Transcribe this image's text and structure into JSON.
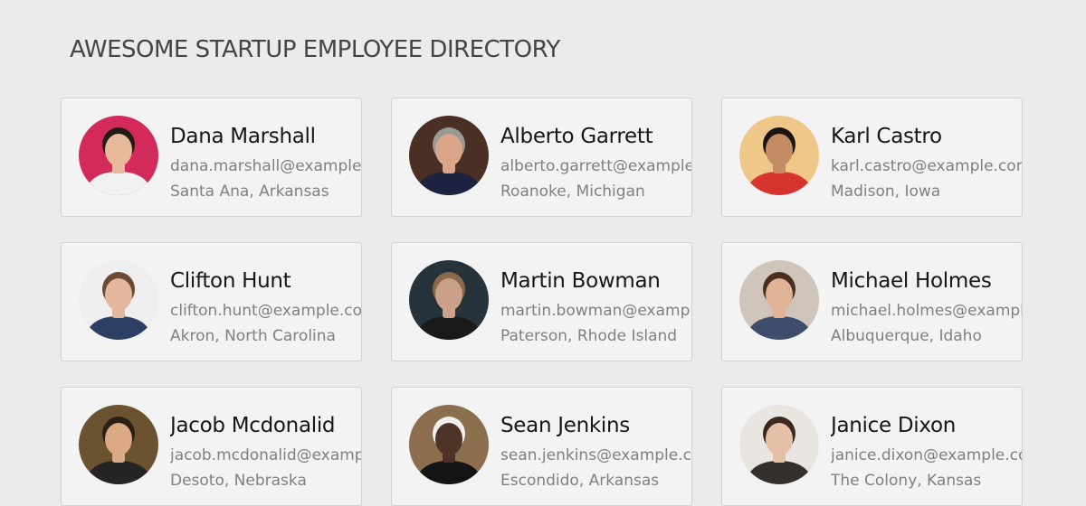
{
  "header": {
    "title": "AWESOME STARTUP EMPLOYEE DIRECTORY"
  },
  "employees": [
    {
      "name": "Dana Marshall",
      "email": "dana.marshall@example.com",
      "location": "Santa Ana, Arkansas",
      "avatar": {
        "bg": "#d22a5a",
        "skin": "#e8b89a",
        "hair": "#221a17",
        "shirt": "#f1f1f1"
      }
    },
    {
      "name": "Alberto Garrett",
      "email": "alberto.garrett@example.com",
      "location": "Roanoke, Michigan",
      "avatar": {
        "bg": "#4a2f24",
        "skin": "#dba58a",
        "hair": "#9a9a95",
        "shirt": "#1c2240"
      }
    },
    {
      "name": "Karl Castro",
      "email": "karl.castro@example.com",
      "location": "Madison, Iowa",
      "avatar": {
        "bg": "#efc789",
        "skin": "#c38c64",
        "hair": "#1a1411",
        "shirt": "#d6352f"
      }
    },
    {
      "name": "Clifton Hunt",
      "email": "clifton.hunt@example.com",
      "location": "Akron, North Carolina",
      "avatar": {
        "bg": "#eeeeee",
        "skin": "#e3b79d",
        "hair": "#6b4a34",
        "shirt": "#2e3f66"
      }
    },
    {
      "name": "Martin Bowman",
      "email": "martin.bowman@example.com",
      "location": "Paterson, Rhode Island",
      "avatar": {
        "bg": "#26333a",
        "skin": "#caa088",
        "hair": "#8a6a48",
        "shirt": "#1a1a1a"
      }
    },
    {
      "name": "Michael Holmes",
      "email": "michael.holmes@example.com",
      "location": "Albuquerque, Idaho",
      "avatar": {
        "bg": "#cfc5bb",
        "skin": "#e0b296",
        "hair": "#4a2e20",
        "shirt": "#3f4d6c"
      }
    },
    {
      "name": "Jacob Mcdonalid",
      "email": "jacob.mcdonalid@example.com",
      "location": "Desoto, Nebraska",
      "avatar": {
        "bg": "#6b5230",
        "skin": "#dba985",
        "hair": "#2a2018",
        "shirt": "#242424"
      }
    },
    {
      "name": "Sean Jenkins",
      "email": "sean.jenkins@example.com",
      "location": "Escondido, Arkansas",
      "avatar": {
        "bg": "#8a6e4e",
        "skin": "#4e3426",
        "hair": "#f0f0f0",
        "shirt": "#141414"
      }
    },
    {
      "name": "Janice Dixon",
      "email": "janice.dixon@example.com",
      "location": "The Colony, Kansas",
      "avatar": {
        "bg": "#e9e6e2",
        "skin": "#e4c0a6",
        "hair": "#3a2a1e",
        "shirt": "#34302e"
      }
    }
  ]
}
